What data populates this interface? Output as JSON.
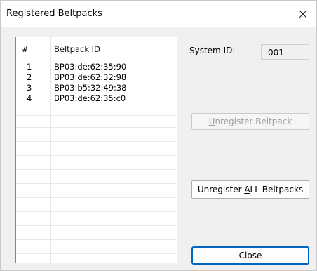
{
  "window": {
    "title": "Registered Beltpacks",
    "close_glyph": "×"
  },
  "list": {
    "headers": [
      "#",
      "Beltpack ID"
    ],
    "rows": [
      {
        "num": "1",
        "id": "BP03:de:62:35:90"
      },
      {
        "num": "2",
        "id": "BP03:de:62:32:98"
      },
      {
        "num": "3",
        "id": "BP03:b5:32:49:38"
      },
      {
        "num": "4",
        "id": "BP03:de:62:35:c0"
      }
    ]
  },
  "system": {
    "label": "System ID:",
    "value": "001"
  },
  "buttons": {
    "unregister_prefix": "",
    "unregister_mnemonic": "U",
    "unregister_suffix": "nregister Beltpack",
    "unregister_enabled": false,
    "unregister_all_prefix": "Unregister ",
    "unregister_all_mnemonic": "A",
    "unregister_all_suffix": "LL Beltpacks",
    "close_label": "Close"
  },
  "colors": {
    "focus_border": "#0067c0",
    "disabled_text": "#a0a0a0",
    "window_bg": "#f0f0f0"
  },
  "icons": {
    "close": "close-icon"
  }
}
